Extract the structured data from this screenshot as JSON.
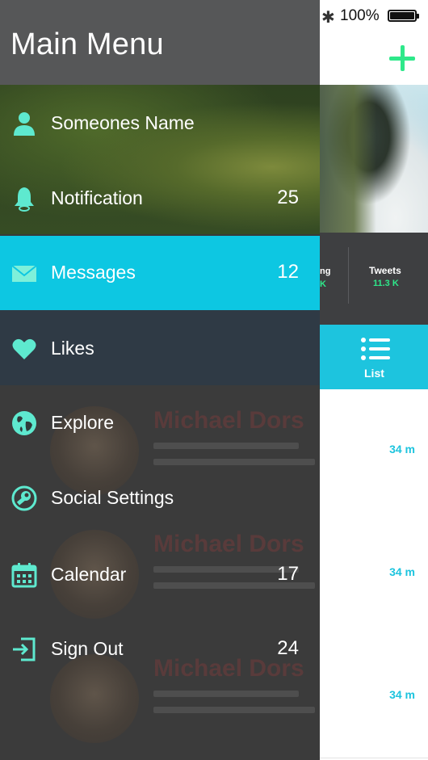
{
  "status": {
    "battery": "100%"
  },
  "drawer": {
    "title": "Main Menu",
    "items": [
      {
        "label": "Someones Name",
        "count": "",
        "icon": "person-icon"
      },
      {
        "label": "Notification",
        "count": "25",
        "icon": "bell-icon"
      },
      {
        "label": "Messages",
        "count": "12",
        "icon": "envelope-icon"
      },
      {
        "label": "Likes",
        "count": "",
        "icon": "heart-icon"
      },
      {
        "label": "Explore",
        "count": "",
        "icon": "globe-icon"
      },
      {
        "label": "Social Settings",
        "count": "",
        "icon": "settings-wrench-icon"
      },
      {
        "label": "Calendar",
        "count": "17",
        "icon": "calendar-icon"
      },
      {
        "label": "Sign Out",
        "count": "24",
        "icon": "sign-out-icon"
      }
    ],
    "active_index": 2,
    "background_feed_names": [
      "Michael Dors",
      "Michael Dors",
      "Michael Dors"
    ]
  },
  "background": {
    "stats": {
      "partial_label": "ng",
      "partial_value": "K",
      "tweets_label": "Tweets",
      "tweets_value": "11.3 K"
    },
    "tab": {
      "label": "List"
    },
    "feed_times": [
      "34 m",
      "34 m",
      "34 m"
    ]
  },
  "colors": {
    "accent": "#0dc7e2",
    "icon": "#5ee9cf",
    "plus": "#2ee88a"
  }
}
